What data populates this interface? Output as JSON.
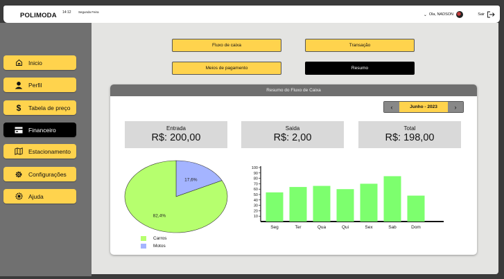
{
  "header": {
    "brand": "POLIMODA",
    "time": "14:12",
    "day": "Segunda Feira",
    "greeting": "Ola, NADSON",
    "logout": "Sair"
  },
  "sidebar": {
    "items": [
      {
        "label": "Inicio",
        "icon": "home-icon"
      },
      {
        "label": "Perfil",
        "icon": "user-icon"
      },
      {
        "label": "Tabela de preço",
        "icon": "dollar-icon"
      },
      {
        "label": "Financeiro",
        "icon": "wallet-icon",
        "active": true
      },
      {
        "label": "Estacionamento",
        "icon": "map-icon"
      },
      {
        "label": "Configurações",
        "icon": "gear-icon"
      },
      {
        "label": "Ajuda",
        "icon": "help-icon"
      }
    ]
  },
  "tabs": {
    "fluxo": "Fluxo de caixa",
    "transacao": "Transação",
    "meios": "Meios de pagamento",
    "resumo": "Resumo"
  },
  "card": {
    "title": "Resumo do Fluxo de Caixa",
    "month": "Junho - 2023",
    "stats": [
      {
        "label": "Entrada",
        "value": "R$: 200,00"
      },
      {
        "label": "Saida",
        "value": "R$: 2,00"
      },
      {
        "label": "Total",
        "value": "R$: 198,00"
      }
    ]
  },
  "colors": {
    "accent": "#ffd34d",
    "carros": "#b6ff6e",
    "motos": "#a4b4ff",
    "bars": "#7dff6e"
  },
  "chart_data": [
    {
      "type": "pie",
      "slices": [
        {
          "label": "Carros",
          "value": 82.4,
          "display": "82,4%"
        },
        {
          "label": "Motos",
          "value": 17.6,
          "display": "17,6%"
        }
      ]
    },
    {
      "type": "bar",
      "categories": [
        "Seg",
        "Ter",
        "Qua",
        "Qui",
        "Sex",
        "Sab",
        "Dom"
      ],
      "values": [
        54,
        64,
        66,
        60,
        70,
        84,
        48
      ],
      "ylim": [
        0,
        100
      ],
      "yticks": [
        10,
        20,
        30,
        40,
        50,
        60,
        70,
        80,
        90,
        100
      ]
    }
  ]
}
